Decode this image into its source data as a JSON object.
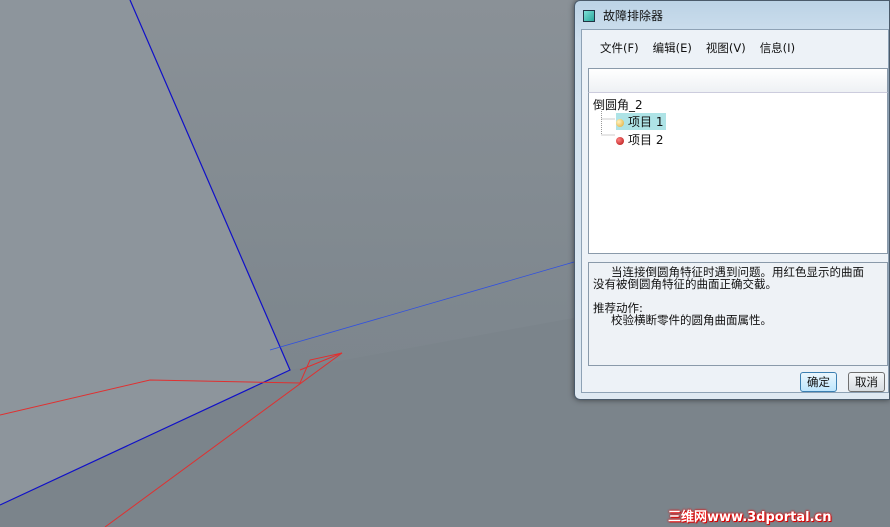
{
  "dialog": {
    "title": "故障排除器",
    "menu": [
      "文件(F)",
      "编辑(E)",
      "视图(V)",
      "信息(I)"
    ],
    "tree": {
      "root": "倒圆角_2",
      "items": [
        {
          "label": "项目 1",
          "status_color": "#f0c860",
          "selected": true
        },
        {
          "label": "项目 2",
          "status_color": "#cc2020",
          "selected": false
        }
      ]
    },
    "message": {
      "line1": "当连接倒圆角特征时遇到问题。用红色显示的曲面",
      "line2": "没有被倒圆角特征的曲面正确交截。",
      "action_heading": "推荐动作:",
      "action": "校验横断零件的圆角曲面属性。"
    },
    "ok_label": "确定",
    "cancel_label": "取消"
  },
  "watermark": "三维网www.3dportal.cn"
}
